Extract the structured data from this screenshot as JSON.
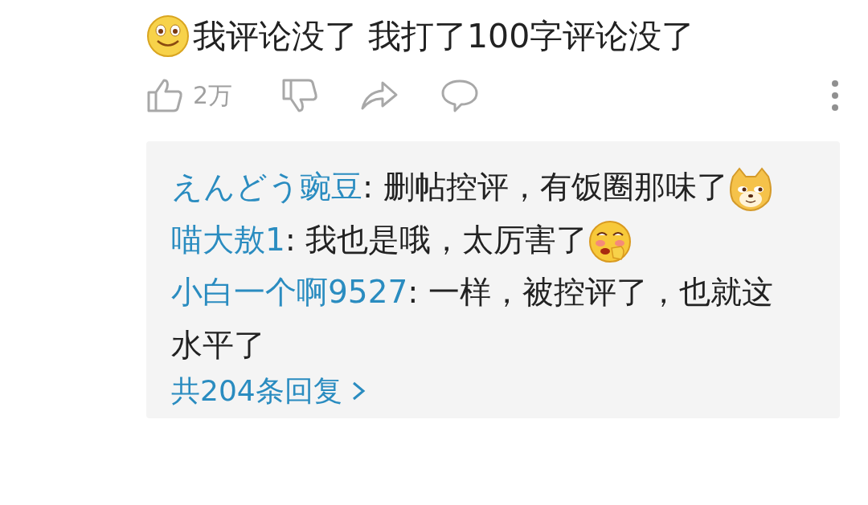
{
  "comment": {
    "text": "我评论没了 我打了100字评论没了"
  },
  "actions": {
    "like_count": "2万"
  },
  "replies": [
    {
      "name": "えんどう豌豆",
      "text": ": 删帖控评，有饭圈那味了"
    },
    {
      "name": "喵大敖1",
      "text": ": 我也是哦，太厉害了"
    },
    {
      "name": "小白一个啊9527",
      "text": ": 一样，被控评了，也就这水平了"
    }
  ],
  "more_replies": "共204条回复"
}
